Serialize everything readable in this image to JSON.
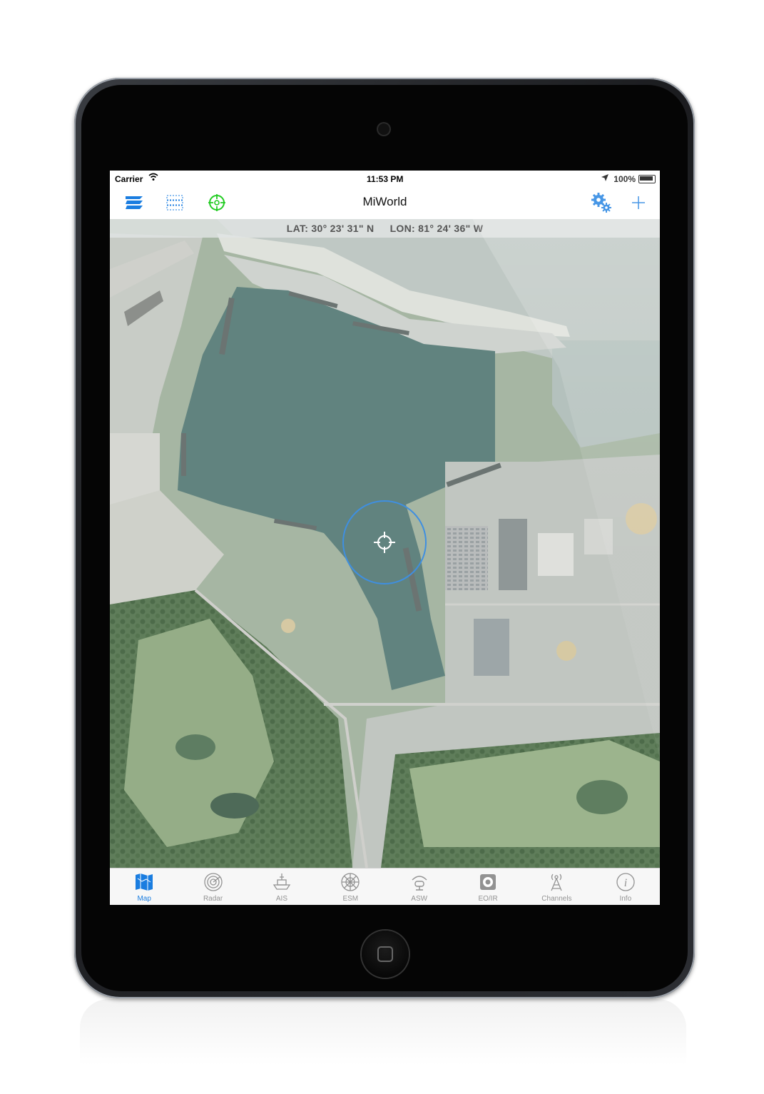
{
  "status_bar": {
    "carrier": "Carrier",
    "time": "11:53 PM",
    "battery": "100%"
  },
  "nav_bar": {
    "title": "MiWorld",
    "icons": [
      "layers-icon",
      "grid-overlay-icon",
      "target-icon",
      "settings-gears-icon",
      "add-icon"
    ]
  },
  "map": {
    "lat_label": "LAT: 30° 23' 31\" N",
    "lon_label": "LON: 81° 24' 36\" W"
  },
  "tabs": [
    {
      "label": "Map",
      "icon": "map-icon",
      "active": true
    },
    {
      "label": "Radar",
      "icon": "radar-icon",
      "active": false
    },
    {
      "label": "AIS",
      "icon": "ship-icon",
      "active": false
    },
    {
      "label": "ESM",
      "icon": "esm-dial-icon",
      "active": false
    },
    {
      "label": "ASW",
      "icon": "sonar-icon",
      "active": false
    },
    {
      "label": "EO/IR",
      "icon": "camera-sensor-icon",
      "active": false
    },
    {
      "label": "Channels",
      "icon": "antenna-tower-icon",
      "active": false
    },
    {
      "label": "Info",
      "icon": "info-icon",
      "active": false
    }
  ],
  "colors": {
    "accent": "#1a7de0",
    "target_green": "#22cc22",
    "inactive_tab": "#929292"
  }
}
